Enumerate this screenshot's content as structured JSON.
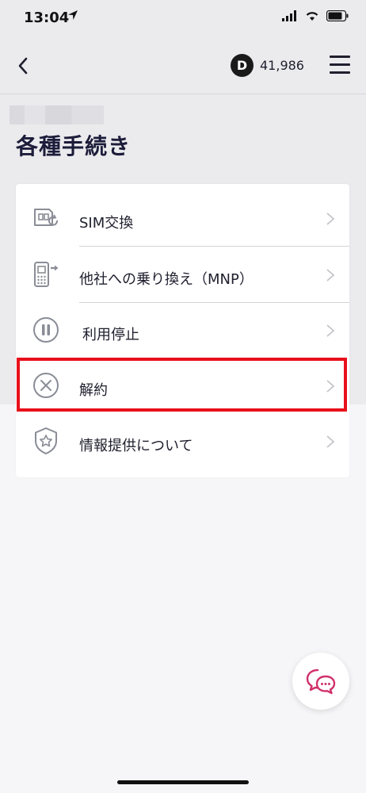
{
  "status_bar": {
    "time": "13:04"
  },
  "header": {
    "points_badge_letter": "D",
    "points_value": "41,986"
  },
  "page": {
    "title": "各種手続き"
  },
  "menu_items": [
    {
      "label": "SIM交換",
      "icon": "sim-swap-icon"
    },
    {
      "label": "他社への乗り換え（MNP）",
      "icon": "phone-transfer-icon"
    },
    {
      "label": "利用停止",
      "icon": "pause-icon"
    },
    {
      "label": "解約",
      "icon": "cancel-circle-icon"
    },
    {
      "label": "情報提供について",
      "icon": "shield-star-icon"
    }
  ],
  "colors": {
    "highlight": "#e8101a",
    "chat_icon": "#d1306b",
    "title": "#1c1c3a"
  }
}
